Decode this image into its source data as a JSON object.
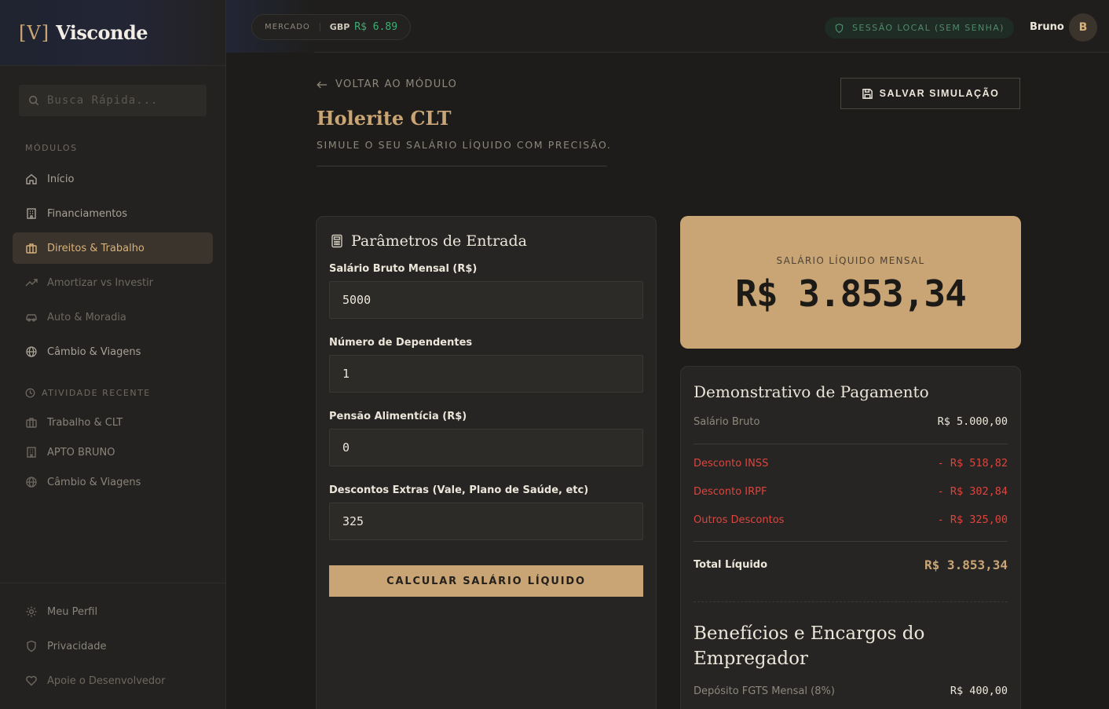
{
  "brand": {
    "mark": "[V]",
    "name": "Visconde"
  },
  "search": {
    "placeholder": "Busca Rápida..."
  },
  "sidebar": {
    "modules_label": "MÓDULOS",
    "modules": [
      {
        "label": "Início",
        "icon": "home-icon"
      },
      {
        "label": "Financiamentos",
        "icon": "building-icon"
      },
      {
        "label": "Direitos & Trabalho",
        "icon": "briefcase-icon",
        "active": true
      },
      {
        "label": "Amortizar vs Investir",
        "icon": "trending-up-icon"
      },
      {
        "label": "Auto & Moradia",
        "icon": "car-icon"
      },
      {
        "label": "Câmbio & Viagens",
        "icon": "globe-icon"
      }
    ],
    "recent_label": "ATIVIDADE RECENTE",
    "recent": [
      {
        "label": "Trabalho & CLT",
        "icon": "briefcase-icon"
      },
      {
        "label": "APTO BRUNO",
        "icon": "building-icon"
      },
      {
        "label": "Câmbio & Viagens",
        "icon": "globe-icon"
      }
    ],
    "footer": [
      {
        "label": "Meu Perfil",
        "icon": "gear-icon"
      },
      {
        "label": "Privacidade",
        "icon": "shield-icon"
      },
      {
        "label": "Apoie o Desenvolvedor",
        "icon": "heart-icon"
      }
    ]
  },
  "topbar": {
    "market_label": "MERCADO",
    "currency": "GBP",
    "rate": "R$ 6.89",
    "session": "SESSÃO LOCAL (SEM SENHA)",
    "user_name": "Bruno",
    "avatar_initial": "B"
  },
  "header": {
    "back": "VOLTAR AO MÓDULO",
    "title": "Holerite CLT",
    "subtitle": "SIMULE O SEU SALÁRIO LÍQUIDO COM PRECISÃO.",
    "save": "SALVAR SIMULAÇÃO"
  },
  "inputs": {
    "title": "Parâmetros de Entrada",
    "fields": [
      {
        "label": "Salário Bruto Mensal (R$)",
        "value": "5000"
      },
      {
        "label": "Número de Dependentes",
        "value": "1"
      },
      {
        "label": "Pensão Alimentícia (R$)",
        "value": "0"
      },
      {
        "label": "Descontos Extras (Vale, Plano de Saúde, etc)",
        "value": "325"
      }
    ],
    "calculate": "CALCULAR SALÁRIO LÍQUIDO"
  },
  "result": {
    "label": "SALÁRIO LÍQUIDO MENSAL",
    "value": "R$ 3.853,34"
  },
  "statement": {
    "title": "Demonstrativo de Pagamento",
    "gross": {
      "label": "Salário Bruto",
      "value": "R$ 5.000,00"
    },
    "deductions": [
      {
        "label": "Desconto INSS",
        "value": "- R$ 518,82"
      },
      {
        "label": "Desconto IRPF",
        "value": "- R$ 302,84"
      },
      {
        "label": "Outros Descontos",
        "value": "- R$ 325,00"
      }
    ],
    "total": {
      "label": "Total Líquido",
      "value": "R$ 3.853,34"
    },
    "benefits_title": "Benefícios e Encargos do Empregador",
    "fgts": {
      "label": "Depósito FGTS Mensal (8%)",
      "value": "R$ 400,00"
    }
  },
  "colors": {
    "accent": "#c9a575",
    "negative": "#d9463f",
    "positive": "#3fae74",
    "background": "#1d1c1a"
  }
}
